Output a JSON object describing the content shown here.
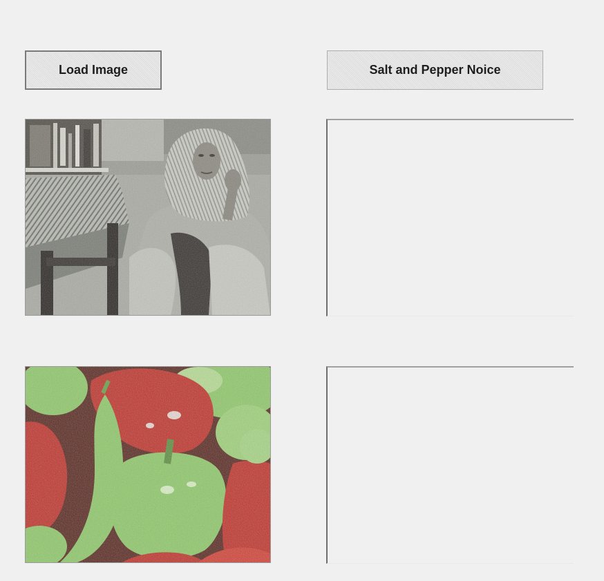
{
  "buttons": {
    "load_label": "Load Image",
    "noise_label": "Salt and Pepper Noice"
  },
  "images": {
    "top_input": "grayscale photo of woman in headscarf seated on floor beside table",
    "bottom_input": "photo of red and green bell peppers"
  },
  "colors": {
    "background": "#f0f0f0",
    "button_face": "#e1e1e1",
    "pepper_red": "#c0342c",
    "pepper_green": "#8fc96a"
  }
}
